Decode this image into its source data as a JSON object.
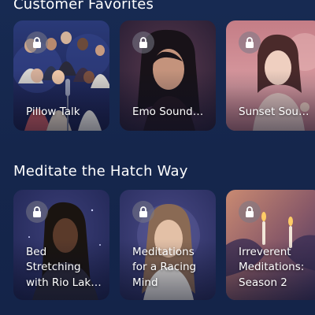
{
  "sections": [
    {
      "title": "Customer Favorites",
      "cards": [
        {
          "label": "Pillow Talk",
          "locked": true,
          "icon": "lock-icon"
        },
        {
          "label": "Emo Sound…",
          "locked": true,
          "icon": "lock-icon"
        },
        {
          "label": "Sunset Soun…",
          "locked": true,
          "icon": "lock-icon"
        }
      ]
    },
    {
      "title": "Meditate the Hatch Way",
      "cards": [
        {
          "label": "Bed Stretching with Rio Lak…",
          "locked": true,
          "icon": "lock-icon"
        },
        {
          "label": "Meditations for a Racing Mind",
          "locked": true,
          "icon": "lock-icon"
        },
        {
          "label": "Irreverent Meditations: Season 2",
          "locked": true,
          "icon": "lock-icon"
        }
      ]
    }
  ],
  "colors": {
    "background": "#15264c",
    "card_text": "#ffffff",
    "lock_badge": "#787887"
  }
}
